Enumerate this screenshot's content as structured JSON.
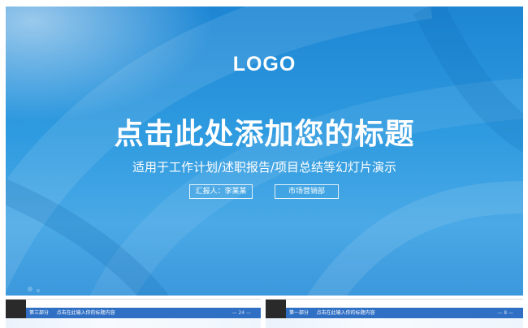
{
  "slide": {
    "logo": "LOGO",
    "title": "点击此处添加您的标题",
    "subtitle": "适用于工作计划/述职报告/项目总结等幻灯片演示",
    "reporter_label": "汇报人：李某某",
    "department_label": "市场营销部"
  },
  "thumbnails": [
    {
      "section": "第三部分",
      "heading": "点击在此输入你的标题内容",
      "page": "— 24 —"
    },
    {
      "section": "第一部分",
      "heading": "点击在此输入你的标题内容",
      "page": "— 8 —"
    }
  ],
  "colors": {
    "slide_blue": "#1d86d4",
    "slide_blue_light": "#4aa9e6",
    "thumb_bar": "#2f6fc4"
  }
}
